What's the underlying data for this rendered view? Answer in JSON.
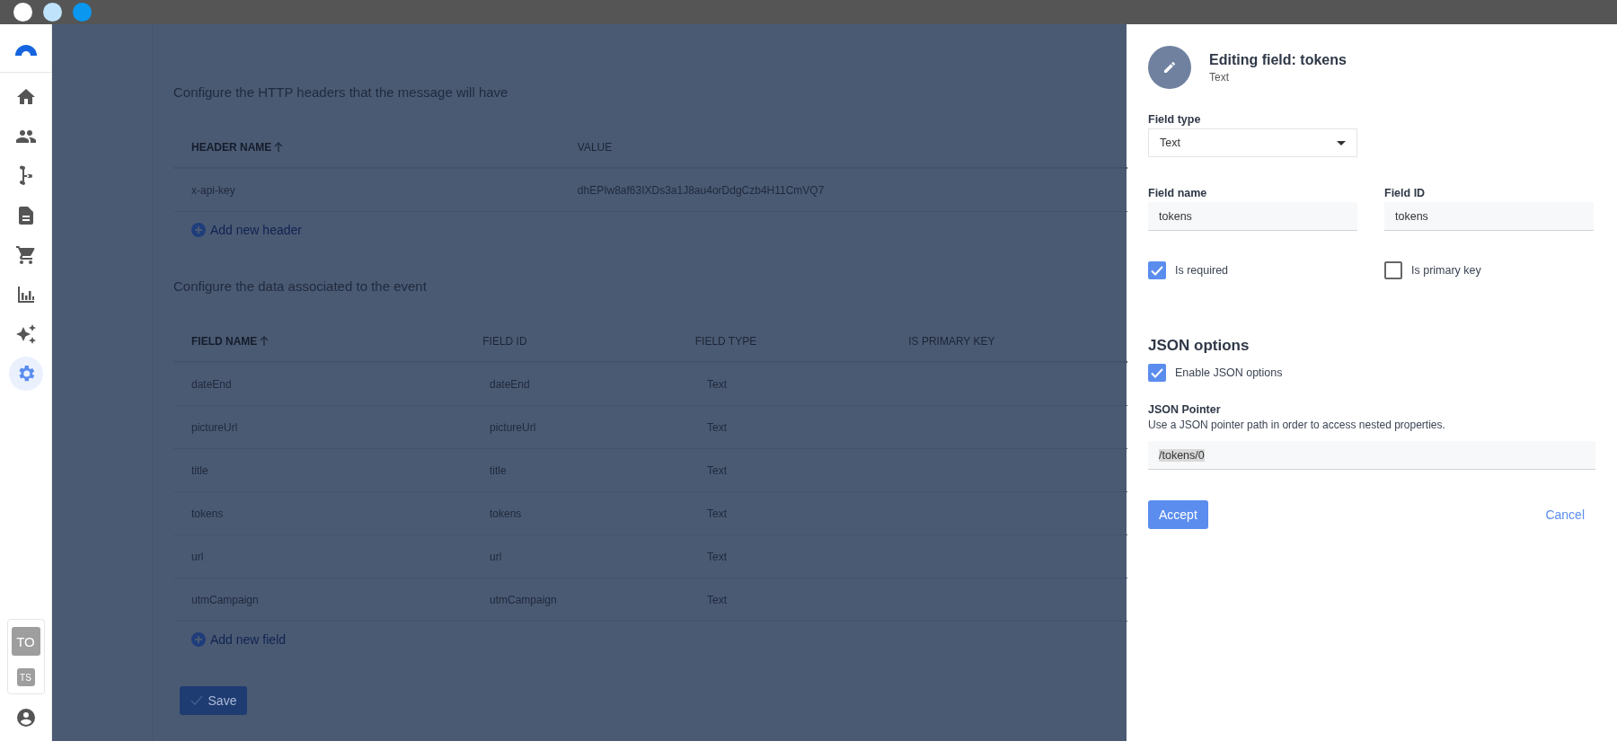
{
  "sidebar": {
    "items": [
      {
        "selected": false
      },
      {
        "selected": false
      },
      {
        "selected": false
      },
      {
        "selected": false
      },
      {
        "selected": false
      },
      {
        "selected": false
      },
      {
        "selected": false
      },
      {
        "selected": true
      }
    ],
    "workspaces": [
      {
        "initials": "TO",
        "selected": true
      },
      {
        "initials": "TS",
        "selected": false
      }
    ]
  },
  "headers_section": {
    "heading": "Configure the HTTP headers that the message will have",
    "columns": [
      {
        "label": "HEADER NAME",
        "sorted": true
      },
      {
        "label": "VALUE",
        "sorted": false
      }
    ],
    "rows": [
      [
        "x-api-key",
        "dhEPIw8af63IXDs3a1J8au4orDdgCzb4H11CmVQ7"
      ]
    ],
    "add_link": "Add new header"
  },
  "fields_section": {
    "heading": "Configure the data associated to the event",
    "columns": [
      {
        "label": "FIELD NAME",
        "sorted": true
      },
      {
        "label": "FIELD ID",
        "sorted": false
      },
      {
        "label": "FIELD TYPE",
        "sorted": false
      },
      {
        "label": "IS PRIMARY KEY",
        "sorted": false
      }
    ],
    "rows": [
      [
        "dateEnd",
        "dateEnd",
        "Text"
      ],
      [
        "pictureUrl",
        "pictureUrl",
        "Text"
      ],
      [
        "title",
        "title",
        "Text"
      ],
      [
        "tokens",
        "tokens",
        "Text"
      ],
      [
        "url",
        "url",
        "Text"
      ],
      [
        "utmCampaign",
        "utmCampaign",
        "Text"
      ]
    ],
    "add_link": "Add new field"
  },
  "save_button": "Save",
  "panel": {
    "title": "Editing field: tokens",
    "subtitle": "Text",
    "field_type": {
      "label": "Field type",
      "value": "Text"
    },
    "field_name": {
      "label": "Field name",
      "value": "tokens"
    },
    "field_id": {
      "label": "Field ID",
      "value": "tokens"
    },
    "checkboxes": [
      {
        "label": "Is required",
        "checked": true
      },
      {
        "label": "Is primary key",
        "checked": false
      }
    ],
    "json_heading": "JSON options",
    "json_enable": {
      "label": "Enable JSON options",
      "checked": true
    },
    "json_pointer": {
      "label": "JSON Pointer",
      "description": "Use a JSON pointer path in order to access nested properties.",
      "value": "/tokens/0"
    },
    "accept": "Accept",
    "cancel": "Cancel"
  }
}
